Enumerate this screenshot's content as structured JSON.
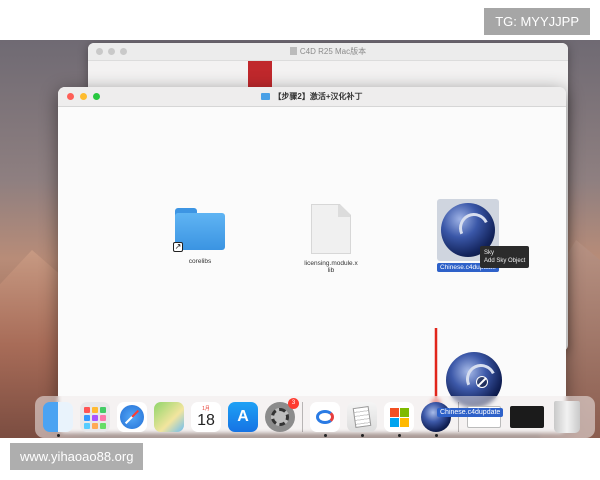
{
  "watermarks": {
    "top_right": "TG: MYYJJPP",
    "bottom_left": "www.yihaoao88.org"
  },
  "back_window": {
    "title": "C4D R25 Mac版本"
  },
  "front_window": {
    "title": "【步骤2】激活+汉化补丁",
    "files": [
      {
        "label": "corelibs",
        "icon": "folder-alias-icon"
      },
      {
        "label": "licensing.module.xlib",
        "icon": "document-icon"
      },
      {
        "label": "Chinese.c4dupdate",
        "icon": "cinema4d-icon",
        "selected": true
      }
    ],
    "tooltip": {
      "line1": "Sky",
      "line2": "Add Sky Object"
    }
  },
  "calendar": {
    "month": "1月",
    "day": "18"
  },
  "settings_badge": "3",
  "app_store_glyph": "A",
  "dock_drag_label": "Chinese.c4dupdate",
  "colors": {
    "selection": "#2e61c9",
    "arrow": "#e1251b",
    "folder": "#4aa0e6"
  }
}
